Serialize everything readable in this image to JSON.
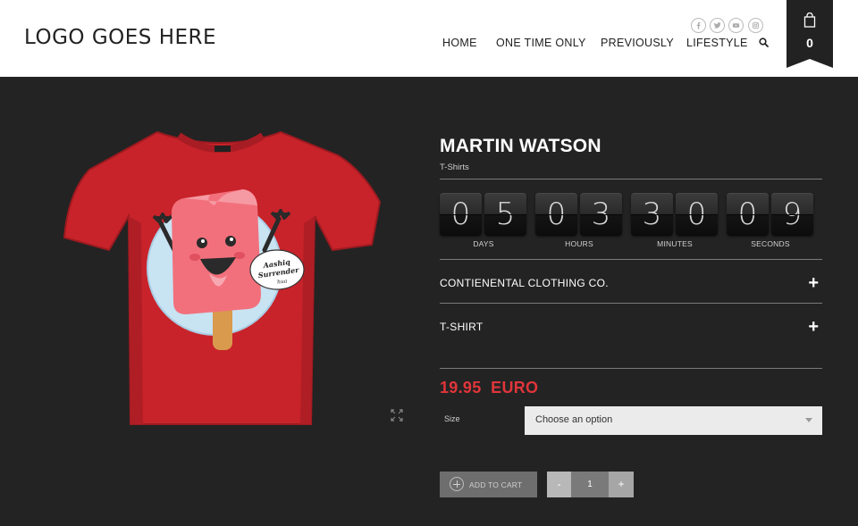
{
  "header": {
    "logo": "LOGO GOES HERE",
    "nav": [
      {
        "label": "HOME"
      },
      {
        "label": "ONE TIME ONLY"
      },
      {
        "label": "PREVIOUSLY"
      },
      {
        "label": "LIFESTYLE"
      }
    ],
    "social_icons": [
      "facebook-icon",
      "twitter-icon",
      "youtube-icon",
      "instagram-icon"
    ],
    "cart_count": "0"
  },
  "product": {
    "title": "MARTIN WATSON",
    "category": "T-Shirts",
    "image_caption": "Aashiq Surrender hua",
    "countdown": {
      "days": [
        "0",
        "5"
      ],
      "hours": [
        "0",
        "3"
      ],
      "minutes": [
        "3",
        "0"
      ],
      "seconds": [
        "0",
        "9"
      ],
      "labels": {
        "days": "DAYS",
        "hours": "HOURS",
        "minutes": "MINUTES",
        "seconds": "SECONDS"
      }
    },
    "accordion": [
      {
        "label": "CONTIENENTAL CLOTHING CO.",
        "icon": "+"
      },
      {
        "label": "T-SHIRT",
        "icon": "+"
      }
    ],
    "price": "19.95  EURO",
    "size": {
      "label": "Size",
      "selected": "Choose an option"
    },
    "add_to_cart": "ADD TO CART",
    "quantity": {
      "minus": "-",
      "value": "1",
      "plus": "+"
    }
  },
  "colors": {
    "background": "#232323",
    "header": "#ffffff",
    "price": "#e0353a",
    "shirt": "#c8232a"
  }
}
